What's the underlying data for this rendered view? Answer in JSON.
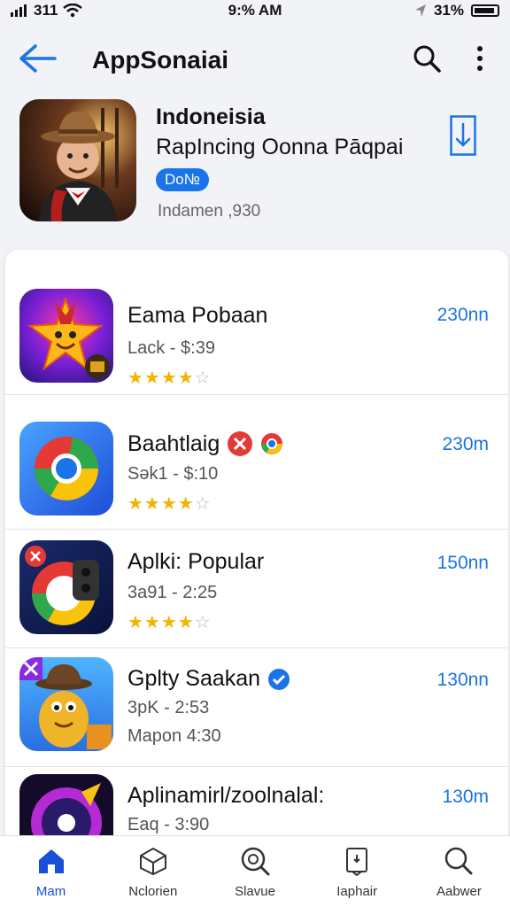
{
  "status_bar": {
    "signal": "311",
    "time": "9:% AM",
    "battery": "31%"
  },
  "header": {
    "title": "AppSonaiai"
  },
  "featured": {
    "title": "Indoneisia",
    "subtitle": "RapIncing Oonna Pāqpai",
    "badge": "Do№",
    "meta": "Indamen ,930"
  },
  "apps": [
    {
      "name": "Eama Pobaan",
      "meta": "Lack - $:39",
      "size": "230nn",
      "rating": 4
    },
    {
      "name": "Baahtlaig",
      "meta": "Sək1 - $:10",
      "size": "230m",
      "rating": 4
    },
    {
      "name": "Aplki: Popular",
      "meta": "3a91 - 2:25",
      "size": "150nn",
      "rating": 4
    },
    {
      "name": "Gplty Saakan",
      "meta": "3pK - 2:53",
      "meta2": "Mapon 4:30",
      "size": "130nn"
    },
    {
      "name": "Aplinamirl/zoolnalal:",
      "meta": "Eaq - 3:90",
      "size": "130m"
    }
  ],
  "nav": [
    {
      "label": "Mam"
    },
    {
      "label": "Nclorien"
    },
    {
      "label": "Slavue"
    },
    {
      "label": "Iaphair"
    },
    {
      "label": "Aabwer"
    }
  ],
  "colors": {
    "accent": "#1a73e8",
    "star": "#f3b400",
    "background": "#f2f3f7"
  }
}
